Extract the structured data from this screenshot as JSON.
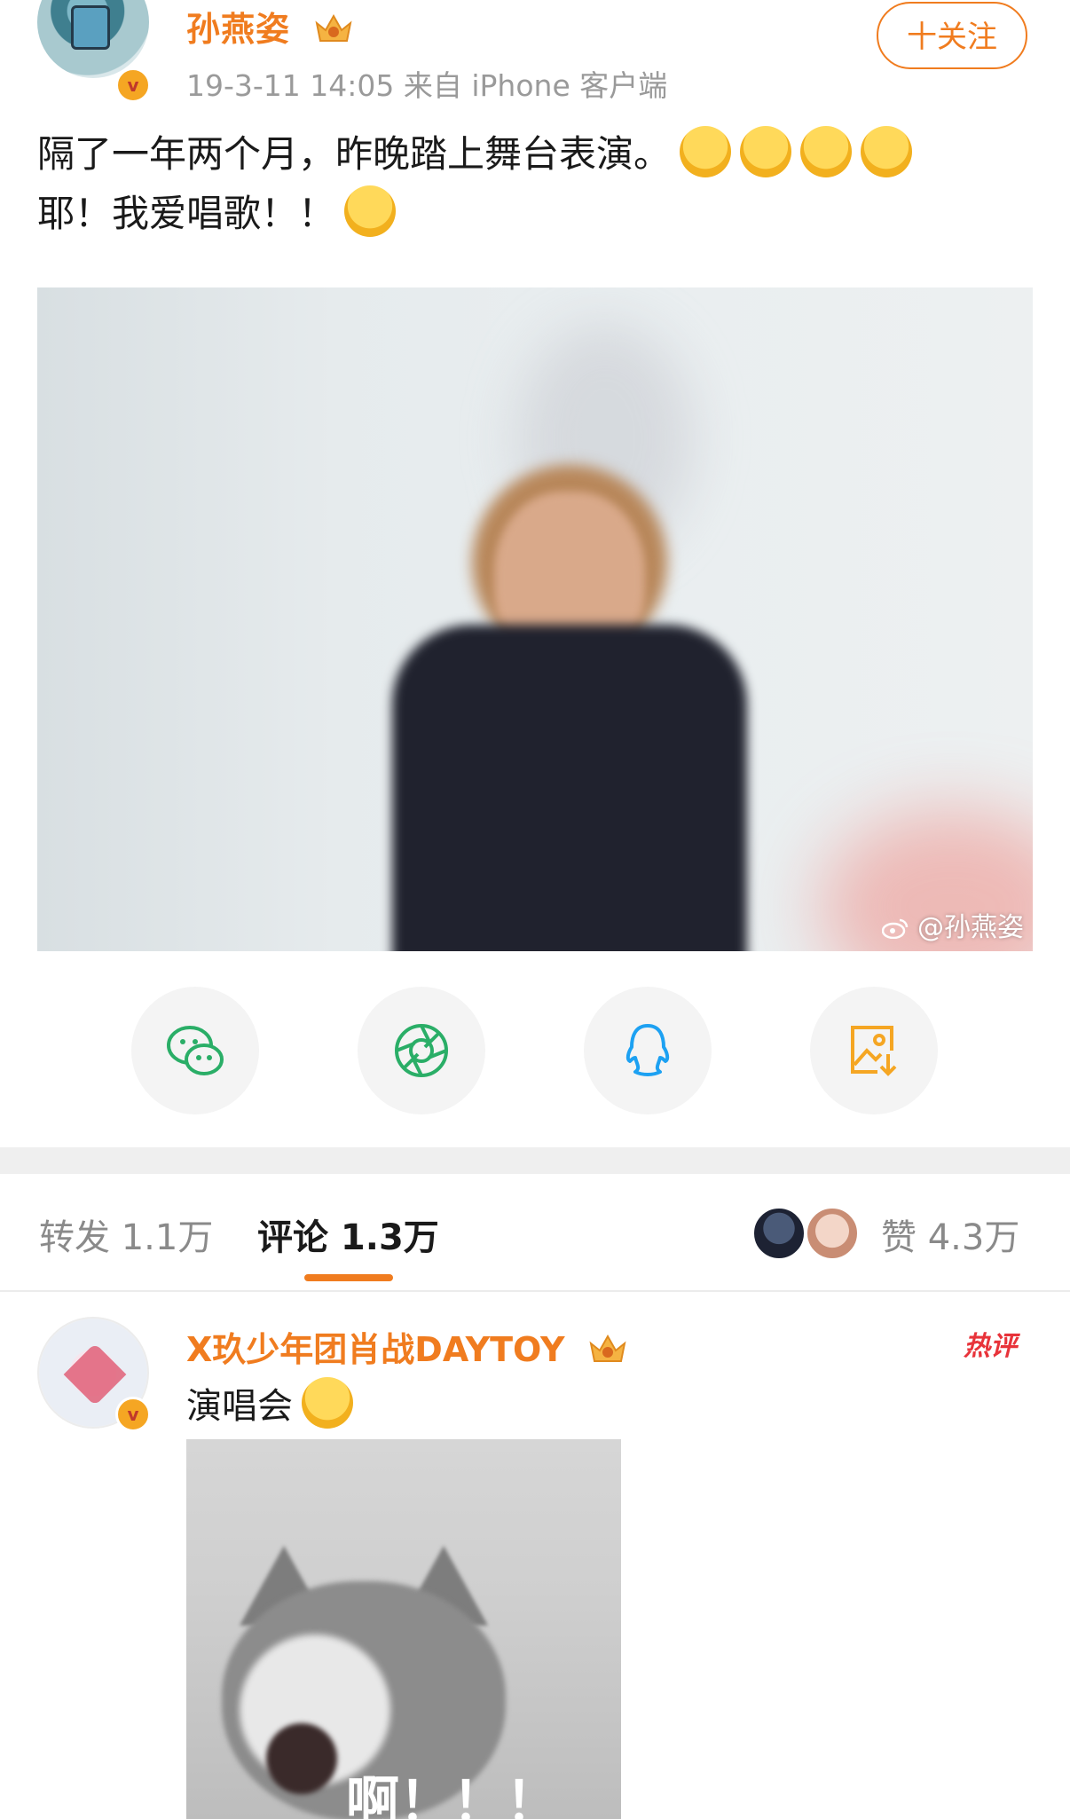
{
  "post": {
    "author": "孙燕姿",
    "meta": "19-3-11 14:05  来自 iPhone 客户端",
    "follow_label": "十关注",
    "text_line1": "隔了一年两个月，昨晚踏上舞台表演。",
    "text_line2": "耶！我爱唱歌！！",
    "watermark": "@孙燕姿"
  },
  "share": {
    "items": [
      "wechat-icon",
      "moments-icon",
      "qq-icon",
      "save-image-icon"
    ],
    "colors": {
      "wechat": "#2aae67",
      "moments": "#2aae67",
      "qq": "#1da1f2",
      "save": "#f5a623"
    }
  },
  "tabs": {
    "repost": "转发 1.1万",
    "comments": "评论 1.3万",
    "likes": "赞 4.3万"
  },
  "comment": {
    "user": "X玖少年团肖战DAYTOY",
    "text": "演唱会",
    "hot_label": "热评",
    "image_caption": "啊！！！"
  },
  "colors": {
    "accent": "#f07c1f",
    "hot": "#e8333a"
  }
}
